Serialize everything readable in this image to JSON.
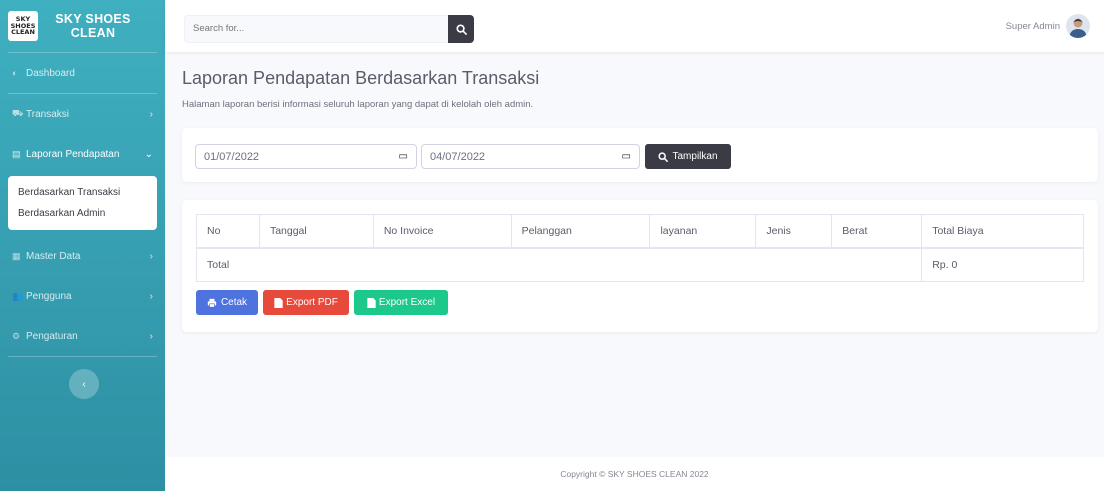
{
  "brand": {
    "logo_lines": [
      "SKY",
      "SHOES",
      "CLEAN"
    ],
    "title": "SKY SHOES CLEAN"
  },
  "sidebar": {
    "items": [
      {
        "label": "Dashboard",
        "icon": "dashboard-icon",
        "has_arrow": false
      },
      {
        "label": "Transaksi",
        "icon": "cart-icon",
        "has_arrow": true
      },
      {
        "label": "Laporan Pendapatan",
        "icon": "report-icon",
        "has_arrow": true,
        "expanded": true
      },
      {
        "label": "Master Data",
        "icon": "database-icon",
        "has_arrow": true
      },
      {
        "label": "Pengguna",
        "icon": "users-icon",
        "has_arrow": true
      },
      {
        "label": "Pengaturan",
        "icon": "gear-icon",
        "has_arrow": true
      }
    ],
    "submenu": [
      "Berdasarkan Transaksi",
      "Berdasarkan Admin"
    ],
    "toggle_icon": "chevron-left-icon"
  },
  "topbar": {
    "search_placeholder": "Search for...",
    "user_name": "Super Admin"
  },
  "page": {
    "title": "Laporan Pendapatan Berdasarkan Transaksi",
    "subtitle": "Halaman laporan berisi informasi seluruh laporan yang dapat di kelolah oleh admin."
  },
  "filter": {
    "start_date": "01/07/2022",
    "end_date": "04/07/2022",
    "button_label": "Tampilkan"
  },
  "table": {
    "headers": [
      "No",
      "Tanggal",
      "No Invoice",
      "Pelanggan",
      "layanan",
      "Jenis",
      "Berat",
      "Total Biaya"
    ],
    "total_label": "Total",
    "total_value": "Rp. 0"
  },
  "actions": {
    "print_label": "Cetak",
    "pdf_label": "Export PDF",
    "excel_label": "Export Excel"
  },
  "colors": {
    "sidebar": "#3fb0c0",
    "print": "#4e73df",
    "pdf": "#e74a3b",
    "excel": "#1cc88a",
    "dark": "#3a3b45"
  },
  "footer": {
    "text": "Copyright © SKY SHOES CLEAN 2022"
  }
}
